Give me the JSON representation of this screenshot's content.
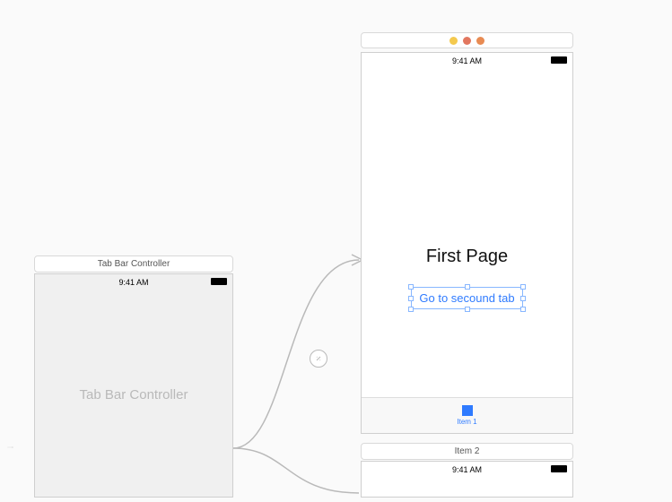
{
  "left_scene": {
    "label": "Tab Bar Controller",
    "status_time": "9:41 AM",
    "placeholder": "Tab Bar Controller"
  },
  "right_scene": {
    "status_time": "9:41 AM",
    "title": "First Page",
    "button": "Go to secound tab",
    "tab_item": "Item 1"
  },
  "second_right_scene": {
    "label": "Item 2",
    "status_time": "9:41 AM"
  },
  "icons": {
    "warning": "warning-dot",
    "error": "error-dot",
    "build": "build-dot"
  }
}
